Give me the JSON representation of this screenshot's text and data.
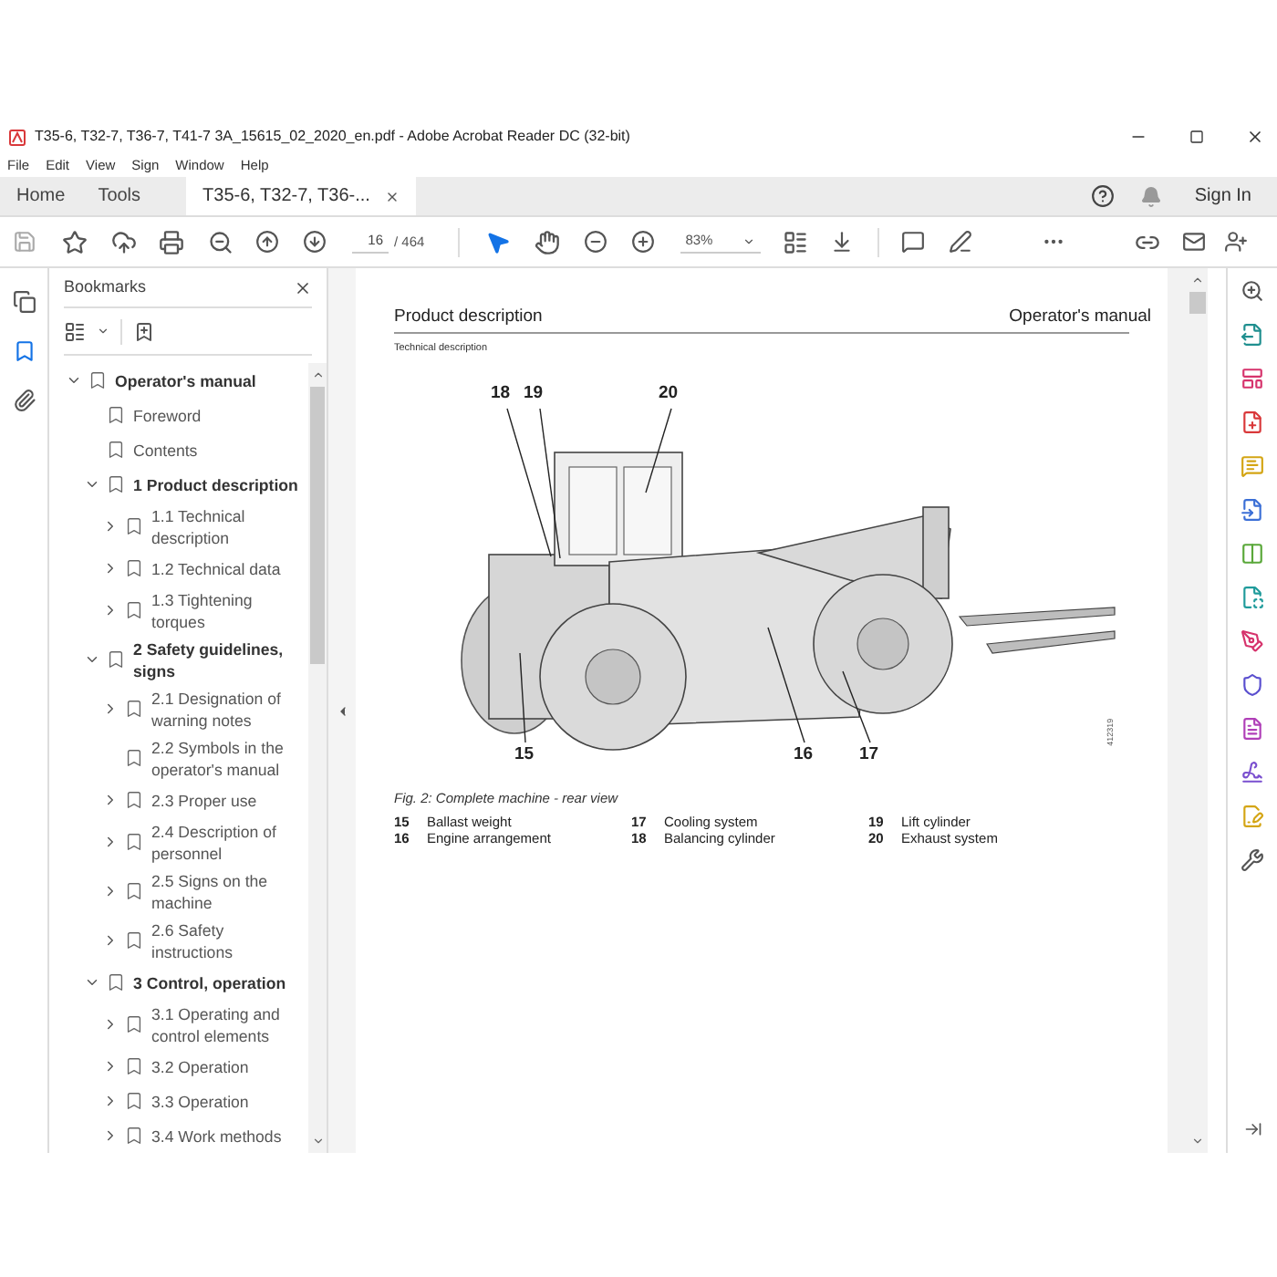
{
  "window": {
    "title": "T35-6, T32-7, T36-7, T41-7 3A_15615_02_2020_en.pdf - Adobe Acrobat Reader DC (32-bit)"
  },
  "menu": [
    "File",
    "Edit",
    "View",
    "Sign",
    "Window",
    "Help"
  ],
  "tabs": [
    {
      "label": "Home",
      "selected": false,
      "closable": false
    },
    {
      "label": "Tools",
      "selected": false,
      "closable": false
    },
    {
      "label": "T35-6, T32-7, T36-...",
      "selected": true,
      "closable": true
    }
  ],
  "account": {
    "sign_in": "Sign In"
  },
  "toolbar": {
    "page": "16",
    "page_count": "/ 464",
    "zoom": "83%",
    "tools": [
      {
        "kind": "select",
        "selected": true
      },
      {
        "kind": "hand",
        "selected": false
      }
    ]
  },
  "side_panels": [
    {
      "kind": "pages",
      "selected": false
    },
    {
      "kind": "bookmarks",
      "selected": true
    },
    {
      "kind": "attachments",
      "selected": false
    }
  ],
  "bookmarks": {
    "title": "Bookmarks",
    "items": [
      {
        "label": "Operator's manual",
        "kind": "group",
        "expanded": true,
        "children": [
          {
            "label": "Foreword",
            "kind": "page"
          },
          {
            "label": "Contents",
            "kind": "page"
          },
          {
            "label": "1 Product description",
            "kind": "group",
            "expanded": true,
            "children": [
              {
                "label": "1.1 Technical description",
                "kind": "group",
                "expanded": false
              },
              {
                "label": "1.2 Technical data",
                "kind": "group",
                "expanded": false
              },
              {
                "label": "1.3 Tightening torques",
                "kind": "group",
                "expanded": false
              }
            ]
          },
          {
            "label": "2 Safety guidelines, signs",
            "kind": "group",
            "expanded": true,
            "children": [
              {
                "label": "2.1 Designation of warning notes",
                "kind": "group",
                "expanded": false
              },
              {
                "label": "2.2 Symbols in the operator's manual",
                "kind": "page"
              },
              {
                "label": "2.3 Proper use",
                "kind": "group",
                "expanded": false
              },
              {
                "label": "2.4 Description of personnel",
                "kind": "group",
                "expanded": false
              },
              {
                "label": "2.5 Signs on the machine",
                "kind": "group",
                "expanded": false
              },
              {
                "label": "2.6 Safety instructions",
                "kind": "group",
                "expanded": false
              }
            ]
          },
          {
            "label": "3 Control, operation",
            "kind": "group",
            "expanded": true,
            "children": [
              {
                "label": "3.1 Operating and control elements",
                "kind": "group",
                "expanded": false
              },
              {
                "label": "3.2 Operation",
                "kind": "group",
                "expanded": false
              },
              {
                "label": "3.3 Operation",
                "kind": "group",
                "expanded": false
              },
              {
                "label": "3.4 Work methods",
                "kind": "group",
                "expanded": false
              }
            ]
          }
        ]
      }
    ]
  },
  "document": {
    "header_left": "Product description",
    "header_right": "Operator's manual",
    "section": "Technical description",
    "figure": {
      "callouts": [
        "18",
        "19",
        "20",
        "15",
        "16",
        "17"
      ],
      "figure_id": "412319",
      "caption": "Fig. 2: Complete machine - rear view",
      "legend": [
        {
          "number": "15",
          "label": "Ballast weight"
        },
        {
          "number": "16",
          "label": "Engine arrangement"
        },
        {
          "number": "17",
          "label": "Cooling system"
        },
        {
          "number": "18",
          "label": "Balancing cylinder"
        },
        {
          "number": "19",
          "label": "Lift cylinder"
        },
        {
          "number": "20",
          "label": "Exhaust system"
        }
      ]
    }
  }
}
